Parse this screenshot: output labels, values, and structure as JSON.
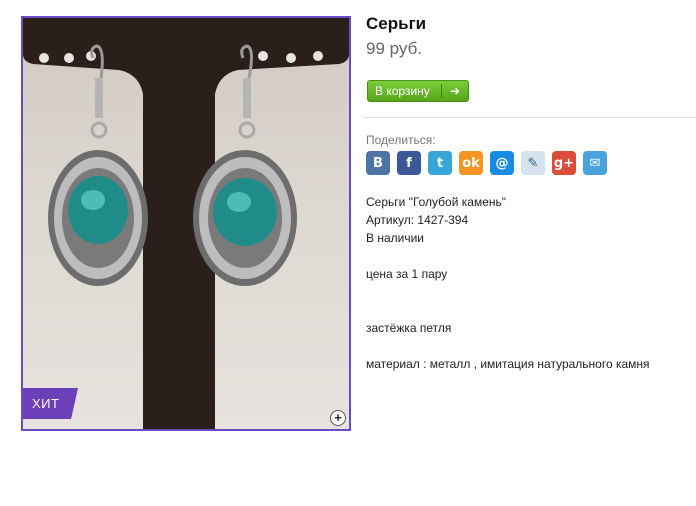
{
  "product": {
    "title": "Серьги",
    "price": "99 руб.",
    "badge": "ХИТ",
    "zoom_icon": "plus-icon"
  },
  "actions": {
    "cart_label": "В корзину",
    "cart_icon": "arrow-right-icon"
  },
  "share": {
    "label": "Поделиться:",
    "services": [
      {
        "name": "vkontakte",
        "glyph": "B",
        "color": "#4c75a3"
      },
      {
        "name": "facebook",
        "glyph": "f",
        "color": "#3b5998"
      },
      {
        "name": "twitter",
        "glyph": "t",
        "color": "#35a6d6"
      },
      {
        "name": "odnoklassniki",
        "glyph": "ok",
        "color": "#f29522"
      },
      {
        "name": "mail-ru",
        "glyph": "@",
        "color": "#168de2"
      },
      {
        "name": "livejournal",
        "glyph": "✎",
        "color": "#d6e2ee"
      },
      {
        "name": "google-plus",
        "glyph": "g+",
        "color": "#dd4b39"
      },
      {
        "name": "email",
        "glyph": "✉",
        "color": "#4aa3df"
      }
    ]
  },
  "description": {
    "name_line": "Серьги \"Голубой камень\"",
    "sku": "Артикул: 1427-394",
    "stock": "В наличии",
    "price_note": "цена за 1 пару",
    "clasp": "застёжка петля",
    "material": "материал : металл , имитация натурального камня"
  }
}
